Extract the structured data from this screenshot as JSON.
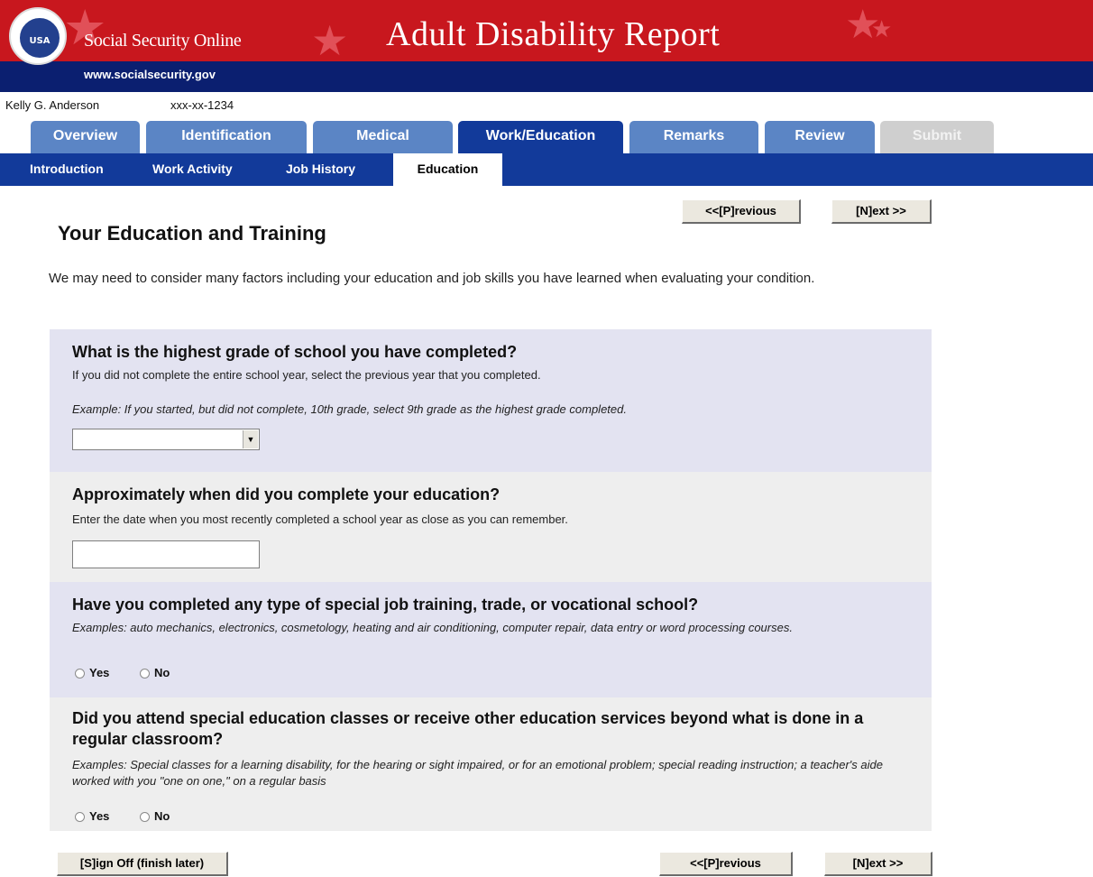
{
  "header": {
    "site_name": "Social Security Online",
    "site_url": "www.socialsecurity.gov",
    "report_title": "Adult Disability Report",
    "seal_text": "USA",
    "colors": {
      "banner_red": "#c8171e",
      "banner_blue": "#0b1f70",
      "tab_blue": "#5b85c5",
      "active_blue": "#123a9a"
    }
  },
  "user": {
    "name": "Kelly G. Anderson",
    "ssn": "xxx-xx-1234"
  },
  "tabs": [
    {
      "label": "Overview",
      "state": "normal"
    },
    {
      "label": "Identification",
      "state": "normal"
    },
    {
      "label": "Medical",
      "state": "normal"
    },
    {
      "label": "Work/Education",
      "state": "active"
    },
    {
      "label": "Remarks",
      "state": "normal"
    },
    {
      "label": "Review",
      "state": "normal"
    },
    {
      "label": "Submit",
      "state": "disabled"
    }
  ],
  "subnav": [
    {
      "label": "Introduction"
    },
    {
      "label": "Work Activity"
    },
    {
      "label": "Job History"
    },
    {
      "label": "Education",
      "active": true
    }
  ],
  "nav_buttons": {
    "previous": "<<[P]revious",
    "next": "[N]ext >>",
    "signoff": "[S]ign Off (finish later)"
  },
  "page": {
    "title": "Your Education and Training",
    "intro": "We may need to consider many factors including your education and job skills you have learned when evaluating your condition."
  },
  "questions": {
    "grade": {
      "title": "What is the highest grade of school you have completed?",
      "help": "If you did not complete the entire school year, select the previous year that you completed.",
      "example": "Example: If you started, but did not complete, 10th grade, select 9th grade as the highest grade completed.",
      "selected_value": ""
    },
    "completion_date": {
      "title": "Approximately when did you complete your education?",
      "help": "Enter the date when you most recently completed a school year as close as you can remember.",
      "value": ""
    },
    "job_training": {
      "title": "Have you completed any type of special job training, trade, or vocational school?",
      "example": "Examples: auto mechanics, electronics, cosmetology, heating and air conditioning, computer repair, data entry or word processing courses.",
      "yes": "Yes",
      "no": "No"
    },
    "special_education": {
      "title": "Did you attend special education classes or receive other education services beyond what is done in a regular classroom?",
      "example": "Examples: Special classes for a learning disability, for the hearing or sight impaired, or for an emotional problem; special reading instruction; a teacher's aide worked with you \"one on one,\"  on a regular basis",
      "yes": "Yes",
      "no": "No"
    }
  }
}
